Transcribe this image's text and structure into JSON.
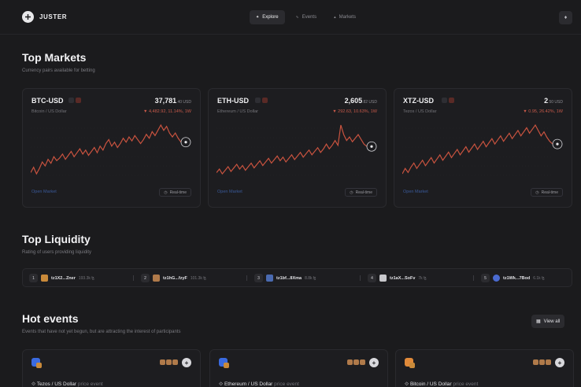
{
  "header": {
    "logo_text": "JUSTER",
    "nav": [
      {
        "label": "Explore",
        "icon": "compass-icon",
        "active": true
      },
      {
        "label": "Events",
        "icon": "events-icon",
        "active": false
      },
      {
        "label": "Markets",
        "icon": "markets-icon",
        "active": false
      }
    ],
    "right_icon": "tezos-icon"
  },
  "top_markets": {
    "title": "Top Markets",
    "subtitle": "Currency pairs available for betting",
    "cards": [
      {
        "pair": "BTC-USD",
        "price_main": "37,781",
        "price_dec": ".40 USD",
        "name": "Bitcoin / US Dollar",
        "change": "▼ 4,482.92, 11.14%, 1W",
        "open_label": "Open Market",
        "realtime_label": "Real-time",
        "series": [
          30,
          34,
          29,
          33,
          38,
          35,
          40,
          37,
          42,
          39,
          41,
          44,
          40,
          43,
          46,
          42,
          45,
          48,
          44,
          47,
          43,
          46,
          49,
          45,
          50,
          47,
          52,
          55,
          50,
          53,
          49,
          52,
          56,
          53,
          57,
          54,
          58,
          55,
          52,
          55,
          59,
          56,
          61,
          58,
          62,
          66,
          62,
          65,
          60,
          57,
          60,
          56,
          53
        ]
      },
      {
        "pair": "ETH-USD",
        "price_main": "2,605",
        "price_dec": ".82 USD",
        "name": "Ethereum / US Dollar",
        "change": "▼ 292.63, 10.63%, 1W",
        "open_label": "Open Market",
        "realtime_label": "Real-time",
        "series": [
          28,
          31,
          27,
          30,
          33,
          29,
          32,
          35,
          31,
          34,
          30,
          33,
          36,
          32,
          35,
          38,
          34,
          37,
          40,
          36,
          39,
          42,
          38,
          41,
          37,
          40,
          43,
          39,
          42,
          45,
          41,
          44,
          47,
          43,
          46,
          49,
          45,
          48,
          52,
          48,
          51,
          55,
          51,
          68,
          60,
          55,
          58,
          54,
          57,
          60,
          56,
          52,
          50
        ]
      },
      {
        "pair": "XTZ-USD",
        "price_main": "2",
        "price_dec": ".50 USD",
        "name": "Tezos / US Dollar",
        "change": "▼ 0.95, 26.42%, 1W",
        "open_label": "Open Market",
        "realtime_label": "Real-time",
        "series": [
          30,
          34,
          31,
          35,
          38,
          34,
          37,
          40,
          36,
          39,
          42,
          38,
          41,
          44,
          40,
          43,
          46,
          42,
          45,
          48,
          44,
          47,
          50,
          46,
          49,
          52,
          48,
          51,
          54,
          50,
          53,
          56,
          52,
          55,
          58,
          54,
          57,
          60,
          56,
          59,
          62,
          58,
          61,
          64,
          60,
          63,
          66,
          62,
          58,
          61,
          57,
          54,
          52
        ]
      }
    ]
  },
  "top_liquidity": {
    "title": "Top Liquidity",
    "subtitle": "Rating of users providing liquidity",
    "items": [
      {
        "rank": "1",
        "address": "tz1X2...Zner",
        "amount": "193.3k ꜩ",
        "avatar_color": "#c98a3a"
      },
      {
        "rank": "2",
        "address": "tz1hG...fzyF",
        "amount": "101.3k ꜩ",
        "avatar_color": "#b07a4a"
      },
      {
        "rank": "3",
        "address": "tz1bf...8Xma",
        "amount": "8.8k ꜩ",
        "avatar_color": "#4a6ab0"
      },
      {
        "rank": "4",
        "address": "tz1aX...SoFv",
        "amount": "7k ꜩ",
        "avatar_color": "#c8c8cc"
      },
      {
        "rank": "5",
        "address": "tz1Wk...7Bod",
        "amount": "6.1k ꜩ",
        "avatar_color": "#4a6ad0"
      }
    ]
  },
  "hot_events": {
    "title": "Hot events",
    "subtitle": "Events that have not yet begun, but are attracting the interest of participants",
    "view_all_label": "View all",
    "cards": [
      {
        "pair": "Tezos / US Dollar",
        "type": "price event",
        "icon_color": "#3a6ae0"
      },
      {
        "pair": "Ethereum / US Dollar",
        "type": "price event",
        "icon_color": "#3a6ae0"
      },
      {
        "pair": "Bitcoin / US Dollar",
        "type": "price event",
        "icon_color": "#e08a3a"
      }
    ]
  },
  "colors": {
    "background": "#1b1b1d",
    "chart_line": "#c9533f",
    "negative": "#c95a4a",
    "link": "#3a5a9a"
  }
}
